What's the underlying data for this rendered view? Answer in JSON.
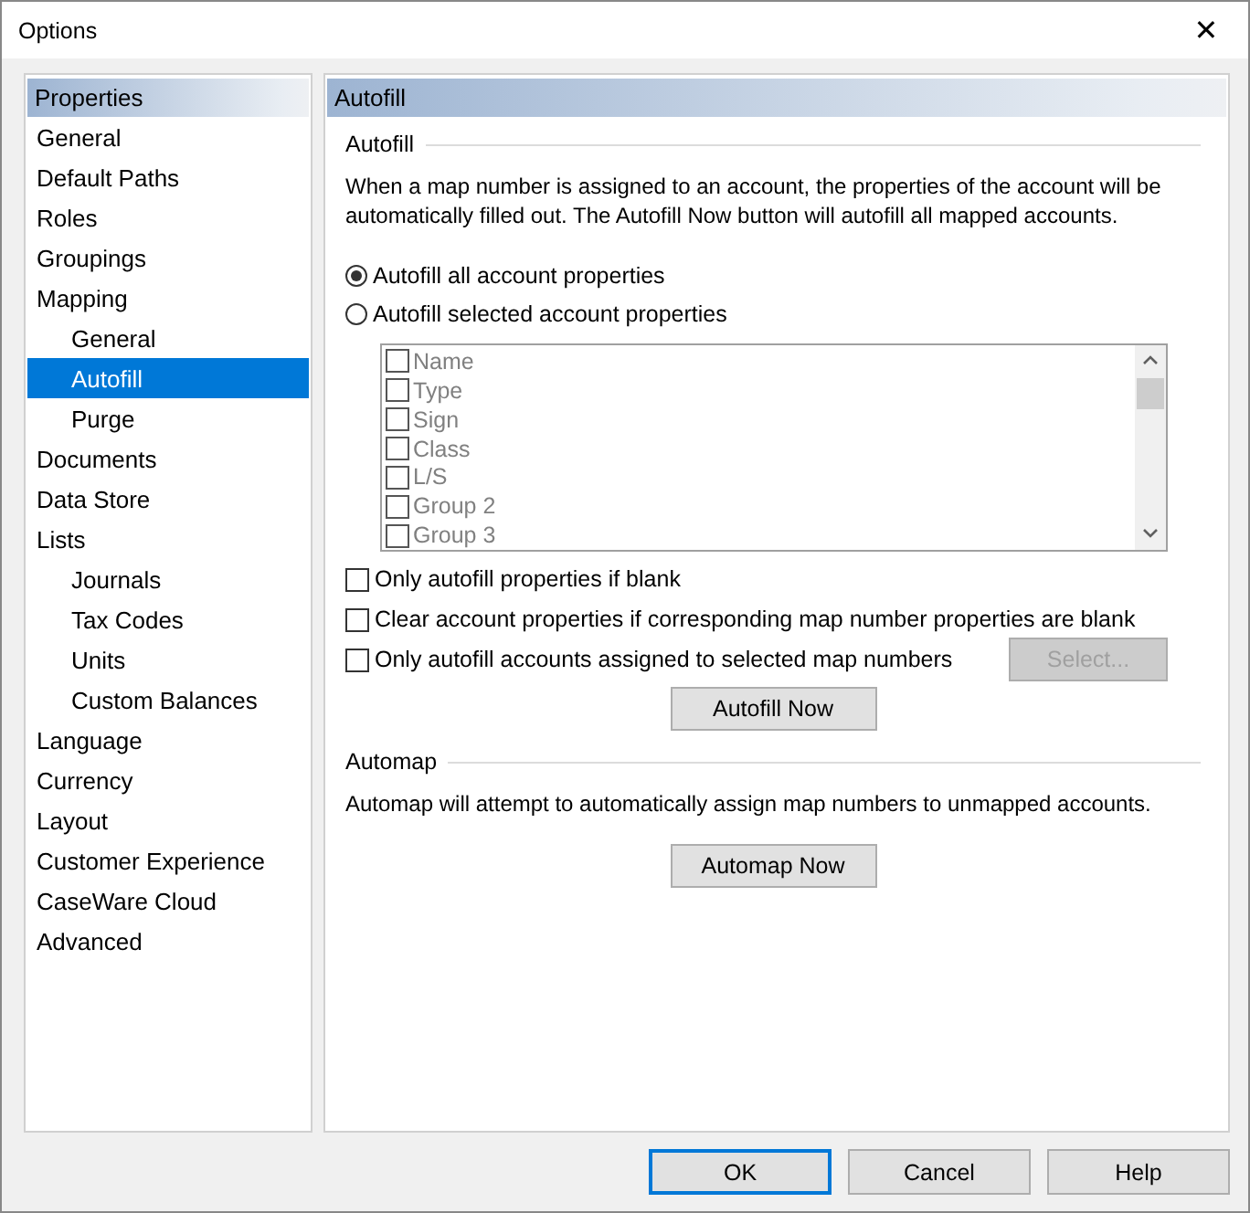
{
  "window": {
    "title": "Options",
    "close": "✕"
  },
  "sidebar": {
    "header": "Properties",
    "items": [
      {
        "label": "General",
        "selected": false
      },
      {
        "label": "Default Paths",
        "selected": false
      },
      {
        "label": "Roles",
        "selected": false
      },
      {
        "label": "Groupings",
        "selected": false
      },
      {
        "label": "Mapping",
        "selected": false,
        "children": [
          {
            "label": "General",
            "selected": false
          },
          {
            "label": "Autofill",
            "selected": true
          },
          {
            "label": "Purge",
            "selected": false
          }
        ]
      },
      {
        "label": "Documents",
        "selected": false
      },
      {
        "label": "Data Store",
        "selected": false
      },
      {
        "label": "Lists",
        "selected": false,
        "children": [
          {
            "label": "Journals",
            "selected": false
          },
          {
            "label": "Tax Codes",
            "selected": false
          },
          {
            "label": "Units",
            "selected": false
          },
          {
            "label": "Custom Balances",
            "selected": false
          }
        ]
      },
      {
        "label": "Language",
        "selected": false
      },
      {
        "label": "Currency",
        "selected": false
      },
      {
        "label": "Layout",
        "selected": false
      },
      {
        "label": "Customer Experience",
        "selected": false
      },
      {
        "label": "CaseWare Cloud",
        "selected": false
      },
      {
        "label": "Advanced",
        "selected": false
      }
    ]
  },
  "panel": {
    "header": "Autofill",
    "autofill": {
      "title": "Autofill",
      "description": "When a map number is assigned to an account, the properties of the account will be automatically filled out. The Autofill Now button will autofill all mapped accounts.",
      "radios": [
        {
          "label": "Autofill all account properties",
          "selected": true
        },
        {
          "label": "Autofill selected account properties",
          "selected": false
        }
      ],
      "property_list": {
        "disabled": true,
        "items": [
          {
            "label": "Name",
            "checked": false
          },
          {
            "label": "Type",
            "checked": false
          },
          {
            "label": "Sign",
            "checked": false
          },
          {
            "label": "Class",
            "checked": false
          },
          {
            "label": "L/S",
            "checked": false
          },
          {
            "label": "Group 2",
            "checked": false
          },
          {
            "label": "Group 3",
            "checked": false
          }
        ]
      },
      "options": [
        {
          "label": "Only autofill properties if blank",
          "checked": false
        },
        {
          "label": "Clear account properties if corresponding map number properties are blank",
          "checked": false
        },
        {
          "label": "Only autofill accounts assigned to selected map numbers",
          "checked": false,
          "button": {
            "label": "Select...",
            "disabled": true
          }
        }
      ],
      "action": "Autofill Now"
    },
    "automap": {
      "title": "Automap",
      "description": "Automap will attempt to automatically assign map numbers to unmapped accounts.",
      "action": "Automap Now"
    }
  },
  "buttons": [
    {
      "label": "OK",
      "default": true
    },
    {
      "label": "Cancel",
      "default": false
    },
    {
      "label": "Help",
      "default": false
    }
  ]
}
